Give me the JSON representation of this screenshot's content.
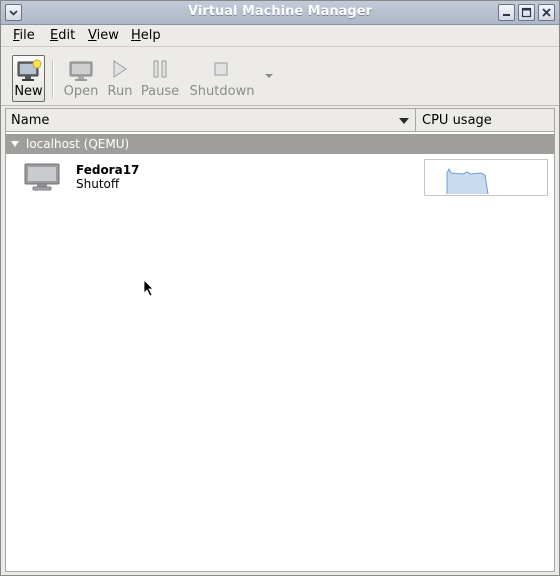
{
  "window": {
    "title": "Virtual Machine Manager"
  },
  "menubar": {
    "items": [
      {
        "label": "File",
        "mnemonic": "F",
        "rest": "ile"
      },
      {
        "label": "Edit",
        "mnemonic": "E",
        "rest": "dit"
      },
      {
        "label": "View",
        "mnemonic": "V",
        "rest": "iew"
      },
      {
        "label": "Help",
        "mnemonic": "H",
        "rest": "elp"
      }
    ]
  },
  "toolbar": {
    "new_label": "New",
    "open_label": "Open",
    "run_label": "Run",
    "pause_label": "Pause",
    "shutdown_label": "Shutdown"
  },
  "list": {
    "columns": {
      "name": "Name",
      "cpu": "CPU usage"
    },
    "group": {
      "label": "localhost (QEMU)"
    },
    "vms": [
      {
        "name": "Fedora17",
        "status": "Shutoff",
        "icon": "monitor-icon"
      }
    ]
  },
  "colors": {
    "group_bg": "#9f9e9a",
    "graph_line": "#6e9fcb",
    "graph_fill": "#c9dcef"
  }
}
